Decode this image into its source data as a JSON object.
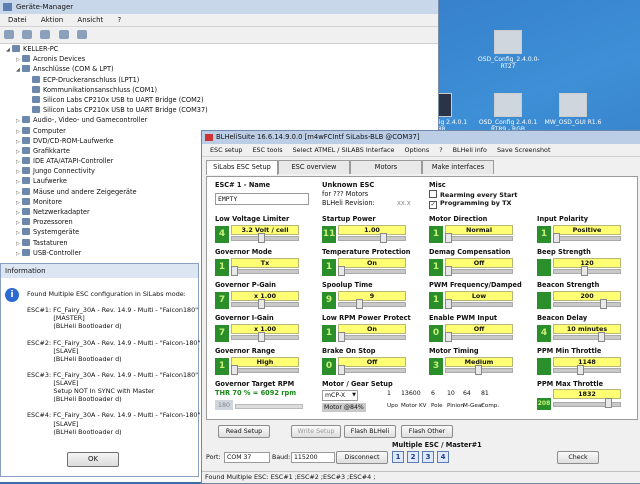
{
  "desktop": {
    "icons": [
      {
        "label": "OSD_Config_2.4.0.0-RT27",
        "dark": false
      },
      {
        "label": "OSD_Config 2.4.0.1 RT89 - RGB",
        "dark": false
      },
      {
        "label": "MW_OSD_GUI R1.6",
        "dark": false
      },
      {
        "label": "OSD_Config 2.4.0.1 RT88",
        "dark": true
      }
    ]
  },
  "device_manager": {
    "title": "Geräte-Manager",
    "menu": [
      "Datei",
      "Aktion",
      "Ansicht",
      "?"
    ],
    "tree": [
      {
        "label": "KELLER-PC",
        "level": 0,
        "expand": "◢"
      },
      {
        "label": "Acronis Devices",
        "level": 1,
        "expand": "▷"
      },
      {
        "label": "Anschlüsse (COM & LPT)",
        "level": 1,
        "expand": "◢"
      },
      {
        "label": "ECP-Druckeranschluss (LPT1)",
        "level": 2,
        "expand": ""
      },
      {
        "label": "Kommunikationsanschluss (COM1)",
        "level": 2,
        "expand": ""
      },
      {
        "label": "Silicon Labs CP210x USB to UART Bridge (COM2)",
        "level": 2,
        "expand": ""
      },
      {
        "label": "Silicon Labs CP210x USB to UART Bridge (COM37)",
        "level": 2,
        "expand": ""
      },
      {
        "label": "Audio-, Video- und Gamecontroller",
        "level": 1,
        "expand": "▷"
      },
      {
        "label": "Computer",
        "level": 1,
        "expand": "▷"
      },
      {
        "label": "DVD/CD-ROM-Laufwerke",
        "level": 1,
        "expand": "▷"
      },
      {
        "label": "Grafikkarte",
        "level": 1,
        "expand": "▷"
      },
      {
        "label": "IDE ATA/ATAPI-Controller",
        "level": 1,
        "expand": "▷"
      },
      {
        "label": "Jungo Connectivity",
        "level": 1,
        "expand": "▷"
      },
      {
        "label": "Laufwerke",
        "level": 1,
        "expand": "▷"
      },
      {
        "label": "Mäuse und andere Zeigegeräte",
        "level": 1,
        "expand": "▷"
      },
      {
        "label": "Monitore",
        "level": 1,
        "expand": "▷"
      },
      {
        "label": "Netzwerkadapter",
        "level": 1,
        "expand": "▷"
      },
      {
        "label": "Prozessoren",
        "level": 1,
        "expand": "▷"
      },
      {
        "label": "Systemgeräte",
        "level": 1,
        "expand": "▷"
      },
      {
        "label": "Tastaturen",
        "level": 1,
        "expand": "▷"
      },
      {
        "label": "USB-Controller",
        "level": 1,
        "expand": "▷"
      }
    ]
  },
  "dialog": {
    "title": "Information",
    "lines": [
      "Found Multiple ESC configuration in SiLabs mode:",
      "",
      "ESC#1: FC_Fairy_30A - Rev. 14.9 - Multi - \"Falcon180\"",
      "             [MASTER]",
      "             (BLHeli Bootloader d)",
      "",
      "ESC#2: FC_Fairy_30A - Rev. 14.9 - Multi - \"Falcon-180\"",
      "             [SLAVE]",
      "             (BLHeli Bootloader d)",
      "",
      "ESC#3: FC_Fairy_30A - Rev. 14.9 - Multi - \"Falcon180\"",
      "             [SLAVE]",
      "             Setup NOT In SYNC with Master",
      "             (BLHeli Bootloader d)",
      "",
      "ESC#4: FC_Fairy_30A - Rev. 14.9 - Multi - \"Falcon-180\"",
      "             [SLAVE]",
      "             (BLHeli Bootloader d)"
    ],
    "ok": "OK"
  },
  "blheli": {
    "title": "BLHeliSuite 16.6.14.9.0.0  [m4wFCIntf SiLabs-BLB @COM37]",
    "menu": [
      "ESC setup",
      "ESC tools",
      "Select ATMEL / SILABS Interface",
      "Options",
      "?",
      "BLHeli info",
      "Save Screenshot"
    ],
    "tabs": [
      "SiLabs ESC Setup",
      "ESC overview",
      "Motors",
      "Make interfaces"
    ],
    "esc_name_label": "ESC# 1 - Name",
    "esc_name_value": "EMPTY",
    "unknown_esc": "Unknown ESC",
    "for_motors": "for ??? Motors",
    "revision": "BLHeli Revision:",
    "revision_value": "xx.x",
    "misc_label": "Misc",
    "misc_opts": [
      {
        "label": "Rearming every Start",
        "checked": false
      },
      {
        "label": "Programming by TX",
        "checked": true
      }
    ],
    "fields": [
      {
        "label": "Low Voltage Limiter",
        "sq": "4",
        "value": "3.2 Volt / cell",
        "pos": 0.45,
        "col": 0,
        "row": 0
      },
      {
        "label": "Startup Power",
        "sq": "11",
        "value": "1.00",
        "pos": 0.7,
        "col": 1,
        "row": 0
      },
      {
        "label": "Motor Direction",
        "sq": "1",
        "value": "Normal",
        "pos": 0.0,
        "col": 2,
        "row": 0
      },
      {
        "label": "Input Polarity",
        "sq": "1",
        "value": "Positive",
        "pos": 0.0,
        "col": 3,
        "row": 0
      },
      {
        "label": "Governor Mode",
        "sq": "1",
        "value": "Tx",
        "pos": 0.0,
        "col": 0,
        "row": 1
      },
      {
        "label": "Temperature Protection",
        "sq": "1",
        "value": "On",
        "pos": 0.0,
        "col": 1,
        "row": 1
      },
      {
        "label": "Demag Compensation",
        "sq": "1",
        "value": "Off",
        "pos": 0.0,
        "col": 2,
        "row": 1
      },
      {
        "label": "Beep Strength",
        "sq": "",
        "value": "120",
        "pos": 0.47,
        "col": 3,
        "row": 1
      },
      {
        "label": "Governor P-Gain",
        "sq": "7",
        "value": "x 1.00",
        "pos": 0.45,
        "col": 0,
        "row": 2
      },
      {
        "label": "Spoolup Time",
        "sq": "9",
        "value": "9",
        "pos": 0.3,
        "col": 1,
        "row": 2
      },
      {
        "label": "PWM Frequency/Damped",
        "sq": "1",
        "value": "Low",
        "pos": 0.0,
        "col": 2,
        "row": 2
      },
      {
        "label": "Beacon Strength",
        "sq": "",
        "value": "200",
        "pos": 0.78,
        "col": 3,
        "row": 2
      },
      {
        "label": "Governor I-Gain",
        "sq": "7",
        "value": "x 1.00",
        "pos": 0.45,
        "col": 0,
        "row": 3
      },
      {
        "label": "Low RPM Power Protect",
        "sq": "1",
        "value": "On",
        "pos": 0.0,
        "col": 1,
        "row": 3
      },
      {
        "label": "Enable PWM Input",
        "sq": "0",
        "value": "Off",
        "pos": 0.0,
        "col": 2,
        "row": 3
      },
      {
        "label": "Beacon Delay",
        "sq": "4",
        "value": "10 minutes",
        "pos": 0.75,
        "col": 3,
        "row": 3
      },
      {
        "label": "Governor Range",
        "sq": "1",
        "value": "High",
        "pos": 0.0,
        "col": 0,
        "row": 4
      },
      {
        "label": "Brake On Stop",
        "sq": "0",
        "value": "Off",
        "pos": 0.0,
        "col": 1,
        "row": 4
      },
      {
        "label": "Motor Timing",
        "sq": "3",
        "value": "Medium",
        "pos": 0.5,
        "col": 2,
        "row": 4
      },
      {
        "label": "PPM Min Throttle",
        "sq": "",
        "value": "1148",
        "pos": 0.4,
        "col": 3,
        "row": 4
      }
    ],
    "gov_target_label": "Governor Target RPM",
    "gov_target_value": "THR 70 % = 6092 rpm",
    "gov_target_sq": "180",
    "motor_gear_label": "Motor / Gear Setup",
    "motor_model": "mCP-X",
    "motor_gear_values": [
      "1",
      "13600",
      "6",
      "10",
      "64",
      "81"
    ],
    "motor_gear_labels": [
      "Upo",
      "Motor KV",
      "Pole",
      "Pinion",
      "M-Gear",
      "Comp."
    ],
    "motor_pct": "Motor @84%",
    "ppm_max_label": "PPM Max Throttle",
    "ppm_max_value": "1832",
    "ppm_max_sq": "208",
    "buttons": {
      "read": "Read Setup",
      "write": "Write Setup",
      "flash_blheli": "Flash BLHeli",
      "flash_other": "Flash Other",
      "disconnect": "Disconnect",
      "check": "Check"
    },
    "port_label": "Port:",
    "port_value": "COM 37",
    "baud_label": "Baud:",
    "baud_value": "115200",
    "multi_esc_label": "Multiple ESC / Master#1",
    "esc_numbers": [
      "1",
      "2",
      "3",
      "4"
    ],
    "status": "Found Multiple ESC: ESC#1 ;ESC#2 ;ESC#3 ;ESC#4 ;"
  }
}
